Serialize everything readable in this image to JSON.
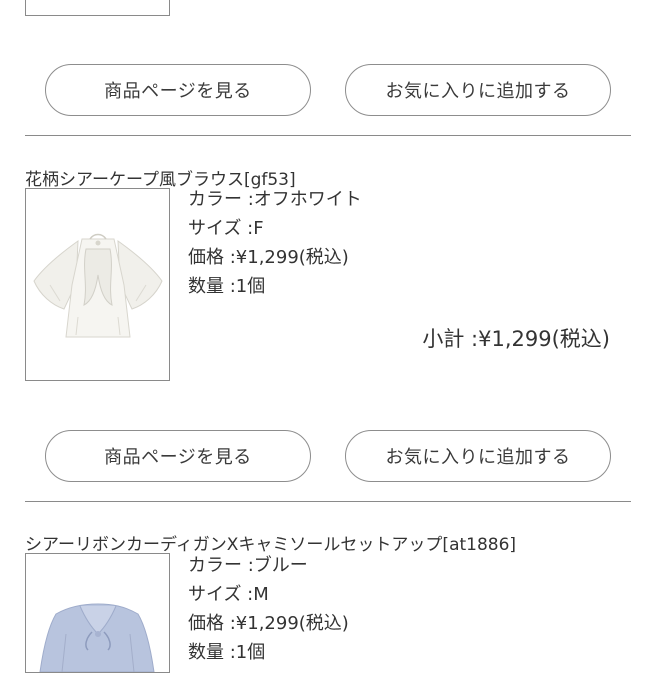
{
  "items": [
    {
      "buttons": {
        "product_page": "商品ページを見る",
        "favorite": "お気に入りに追加する"
      }
    },
    {
      "title": "花柄シアーケープ風ブラウス[gf53]",
      "color": "カラー :オフホワイト",
      "size": "サイズ :F",
      "price": "価格 :¥1,299(税込)",
      "quantity": "数量 :1個",
      "subtotal": "小計 :¥1,299(税込)",
      "image_icon": "white-cape-blouse-image",
      "buttons": {
        "product_page": "商品ページを見る",
        "favorite": "お気に入りに追加する"
      }
    },
    {
      "title": "シアーリボンカーディガンXキャミソールセットアップ[at1886]",
      "color": "カラー :ブルー",
      "size": "サイズ :M",
      "price": "価格 :¥1,299(税込)",
      "quantity": "数量 :1個",
      "image_icon": "blue-cardigan-image"
    }
  ],
  "colors": {
    "text": "#333333",
    "border": "#8a8a8a",
    "background": "#ffffff"
  }
}
